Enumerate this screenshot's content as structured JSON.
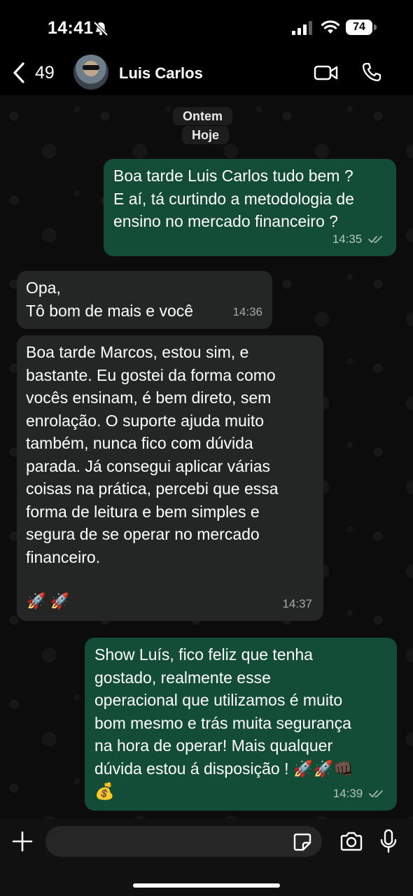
{
  "status_bar": {
    "time": "14:41",
    "battery": "74",
    "icons": [
      "bell-slash-icon",
      "signal-icon",
      "wifi-icon",
      "battery-icon"
    ]
  },
  "header": {
    "back_count": "49",
    "contact_name": "Luis Carlos",
    "icons": [
      "chevron-left-icon",
      "video-icon",
      "phone-icon"
    ]
  },
  "chat": {
    "date_labels": [
      "Ontem",
      "Hoje"
    ],
    "messages": [
      {
        "direction": "out",
        "text": "Boa tarde Luis Carlos tudo bem ?\nE aí, tá curtindo a metodologia de\nensino no mercado financeiro ?",
        "time": "14:35",
        "read": true
      },
      {
        "direction": "in",
        "text": "Opa,\nTô bom de mais e você",
        "time": "14:36"
      },
      {
        "direction": "in",
        "text": "Boa tarde Marcos, estou sim, e\nbastante. Eu gostei da forma como\nvocês ensinam, é bem direto, sem\nenrolação. O suporte ajuda muito\ntambém, nunca fico com dúvida\nparada. Já consegui aplicar várias\ncoisas na prática, percebi que essa\nforma de leitura e bem simples e\nsegura de se operar no mercado\nfinanceiro.",
        "emoji": "🚀  🚀",
        "time": "14:37"
      },
      {
        "direction": "out",
        "text": "Show Luís, fico feliz que tenha\ngostado, realmente esse\noperacional que utilizamos é muito\nbom mesmo e trás muita segurança\nna hora de operar! Mais qualquer\ndúvida estou á disposição ! 🚀🚀👊🏿\n💰",
        "time": "14:39",
        "read": true
      }
    ]
  },
  "input_bar": {
    "placeholder": "",
    "icons": [
      "plus-icon",
      "sticker-icon",
      "camera-icon",
      "mic-icon"
    ]
  },
  "colors": {
    "outgoing_bubble": "#144d37",
    "incoming_bubble": "#242626",
    "read_ticks": "#9fb6ab"
  }
}
